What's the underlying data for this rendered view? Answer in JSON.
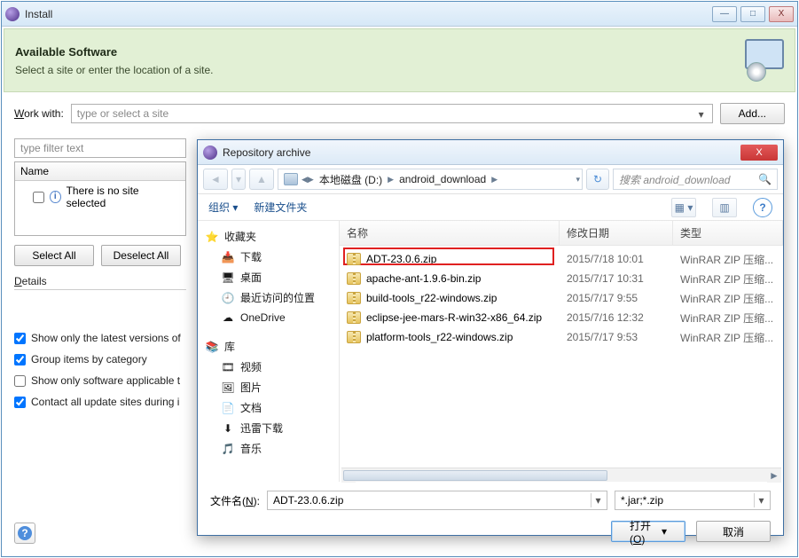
{
  "install": {
    "title": "Install",
    "banner_title": "Available Software",
    "banner_sub": "Select a site or enter the location of a site.",
    "work_with_label": "Work with:",
    "site_placeholder": "type or select a site",
    "add_btn": "Add...",
    "filter_placeholder": "type filter text",
    "tree_header": "Name",
    "tree_empty": "There is no site selected",
    "select_all": "Select All",
    "deselect_all": "Deselect All",
    "details_label": "Details",
    "checks": [
      {
        "label": "Show only the latest versions of",
        "checked": true
      },
      {
        "label": "Group items by category",
        "checked": true
      },
      {
        "label": "Show only software applicable t",
        "checked": false
      },
      {
        "label": "Contact all update sites during i",
        "checked": true
      }
    ],
    "win_btns": {
      "min": "—",
      "max": "□",
      "close": "X"
    }
  },
  "dialog": {
    "title": "Repository archive",
    "close_glyph": "X",
    "nav": {
      "back": "◄",
      "splitCaret": "▾",
      "up": "▲"
    },
    "crumb": {
      "drive_label": "本地磁盘 (D:)",
      "folder": "android_download"
    },
    "refresh_glyph": "↻",
    "search_placeholder": "搜索 android_download",
    "search_icon": "🔍",
    "toolbar": {
      "organize": "组织 ▾",
      "new_folder": "新建文件夹",
      "view": "▦ ▾",
      "preview": "▥",
      "help": "?"
    },
    "sidebar": {
      "fav": "收藏夹",
      "fav_items": [
        "下载",
        "桌面",
        "最近访问的位置",
        "OneDrive"
      ],
      "lib": "库",
      "lib_items": [
        "视频",
        "图片",
        "文档",
        "迅雷下载",
        "音乐"
      ]
    },
    "columns": {
      "name": "名称",
      "date": "修改日期",
      "type": "类型"
    },
    "files": [
      {
        "name": "ADT-23.0.6.zip",
        "date": "2015/7/18 10:01",
        "type": "WinRAR ZIP 压缩..."
      },
      {
        "name": "apache-ant-1.9.6-bin.zip",
        "date": "2015/7/17 10:31",
        "type": "WinRAR ZIP 压缩..."
      },
      {
        "name": "build-tools_r22-windows.zip",
        "date": "2015/7/17 9:55",
        "type": "WinRAR ZIP 压缩..."
      },
      {
        "name": "eclipse-jee-mars-R-win32-x86_64.zip",
        "date": "2015/7/16 12:32",
        "type": "WinRAR ZIP 压缩..."
      },
      {
        "name": "platform-tools_r22-windows.zip",
        "date": "2015/7/17 9:53",
        "type": "WinRAR ZIP 压缩..."
      }
    ],
    "filename_label": "文件名(N):",
    "filename_value": "ADT-23.0.6.zip",
    "filter_value": "*.jar;*.zip",
    "open_btn": "打开(O)",
    "cancel_btn": "取消"
  }
}
